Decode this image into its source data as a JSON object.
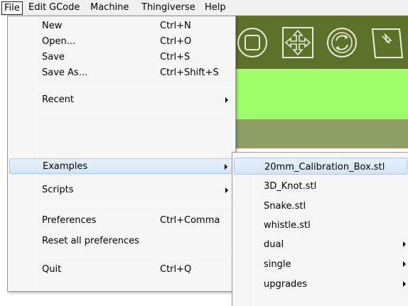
{
  "menubar": {
    "items": [
      "File",
      "Edit",
      "GCode",
      "Machine",
      "Thingiverse",
      "Help"
    ],
    "active": "File"
  },
  "file_menu": {
    "items": [
      {
        "label": "New",
        "accel": "Ctrl+N"
      },
      {
        "label": "Open...",
        "accel": "Ctrl+O"
      },
      {
        "label": "Save",
        "accel": "Ctrl+S"
      },
      {
        "label": "Save As...",
        "accel": "Ctrl+Shift+S"
      },
      {
        "label": "Recent",
        "submenu": true
      },
      {
        "label": "Examples",
        "submenu": true,
        "highlighted": true
      },
      {
        "label": "Scripts",
        "submenu": true
      },
      {
        "label": "Preferences",
        "accel": "Ctrl+Comma"
      },
      {
        "label": "Reset all preferences"
      },
      {
        "label": "Quit",
        "accel": "Ctrl+Q"
      }
    ]
  },
  "examples_submenu": {
    "items": [
      {
        "label": "20mm_Calibration_Box.stl",
        "highlighted": true
      },
      {
        "label": "3D_Knot.stl"
      },
      {
        "label": "Snake.stl"
      },
      {
        "label": "whistle.stl"
      },
      {
        "label": "dual",
        "submenu": true
      },
      {
        "label": "single",
        "submenu": true
      },
      {
        "label": "upgrades",
        "submenu": true
      }
    ]
  },
  "toolbar": {
    "icons": [
      "stop-square-icon",
      "move-arrows-icon",
      "rotate-icon",
      "scale-icon"
    ]
  },
  "colors": {
    "toolbar_bg": "#5e712b",
    "green_band": "#9eff6a",
    "olive_band": "#8f9e66",
    "highlight": "#d3e4f7"
  }
}
